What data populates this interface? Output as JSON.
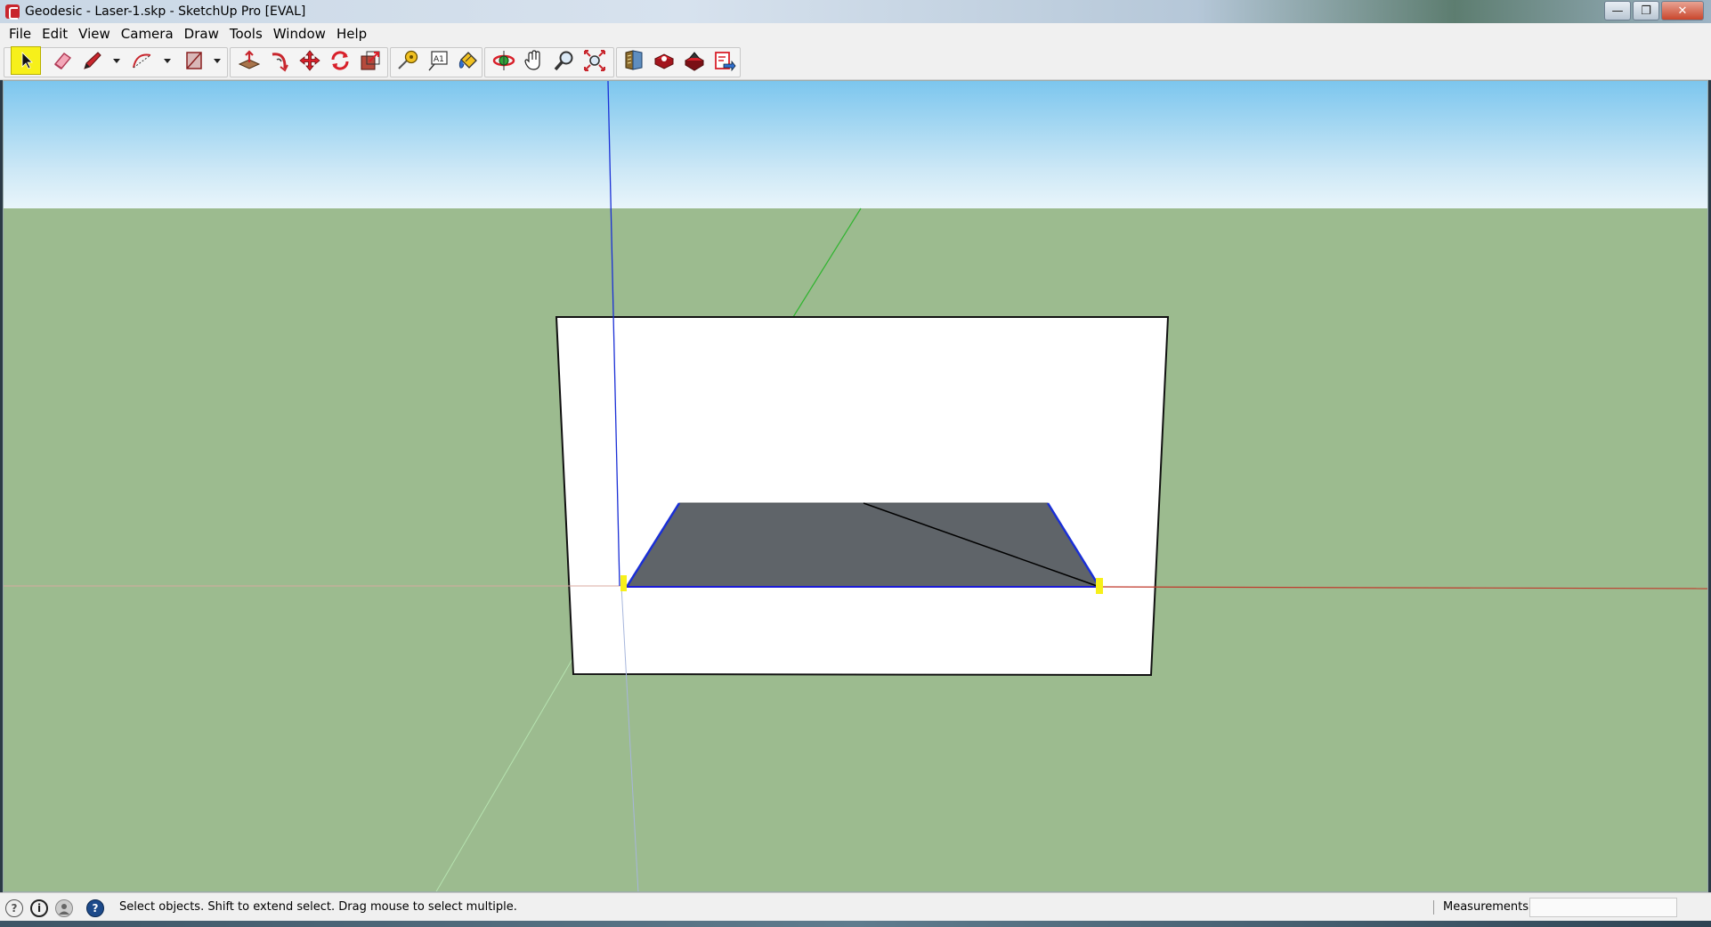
{
  "window": {
    "title": "Geodesic - Laser-1.skp - SketchUp Pro [EVAL]",
    "minimize_glyph": "—",
    "maximize_glyph": "❐",
    "close_glyph": "✕"
  },
  "menu": {
    "items": [
      {
        "id": "file",
        "label": "File"
      },
      {
        "id": "edit",
        "label": "Edit"
      },
      {
        "id": "view",
        "label": "View"
      },
      {
        "id": "camera",
        "label": "Camera"
      },
      {
        "id": "draw",
        "label": "Draw"
      },
      {
        "id": "tools",
        "label": "Tools"
      },
      {
        "id": "window",
        "label": "Window"
      },
      {
        "id": "help",
        "label": "Help"
      }
    ]
  },
  "toolbar": {
    "tools": [
      {
        "name": "select-tool",
        "icon": "arrow-cursor-icon",
        "active": true
      },
      {
        "name": "eraser-tool",
        "icon": "eraser-icon"
      },
      {
        "name": "pencil-tool",
        "icon": "pencil-icon",
        "dropdown": true
      },
      {
        "name": "arc-tool",
        "icon": "arc-icon",
        "dropdown": true
      },
      {
        "name": "rectangle-tool",
        "icon": "rectangle-icon",
        "dropdown": true
      },
      {
        "name": "push-pull-tool",
        "icon": "push-pull-icon"
      },
      {
        "name": "follow-me-tool",
        "icon": "follow-me-icon"
      },
      {
        "name": "move-tool",
        "icon": "move-icon"
      },
      {
        "name": "rotate-tool",
        "icon": "rotate-icon"
      },
      {
        "name": "scale-tool",
        "icon": "scale-icon"
      },
      {
        "name": "tape-measure-tool",
        "icon": "tape-measure-icon"
      },
      {
        "name": "text-tool",
        "icon": "text-icon",
        "text": "A1"
      },
      {
        "name": "paint-bucket-tool",
        "icon": "paint-bucket-icon"
      },
      {
        "name": "orbit-tool",
        "icon": "orbit-icon"
      },
      {
        "name": "pan-tool",
        "icon": "pan-hand-icon"
      },
      {
        "name": "zoom-tool",
        "icon": "zoom-icon"
      },
      {
        "name": "zoom-extents-tool",
        "icon": "zoom-extents-icon"
      },
      {
        "name": "3d-warehouse-tool",
        "icon": "warehouse-icon"
      },
      {
        "name": "share-model-tool",
        "icon": "share-model-icon"
      },
      {
        "name": "extension-warehouse-tool",
        "icon": "extension-warehouse-icon"
      },
      {
        "name": "send-to-layout-tool",
        "icon": "send-to-layout-icon"
      }
    ]
  },
  "scene": {
    "colors": {
      "sky_top": "#7cc6ee",
      "ground": "#9cbb8f",
      "face_white": "#ffffff",
      "face_gray": "#5f6469",
      "axis_blue": "#1a2fd6",
      "axis_red": "#c0392b",
      "axis_green": "#2fb42f",
      "selected_edge": "#1a1ad6",
      "endpoint_marker": "#f7f01a"
    }
  },
  "status": {
    "text": "Select objects. Shift to extend select. Drag mouse to select multiple.",
    "measurements_label": "Measurements",
    "measurements_value": ""
  }
}
